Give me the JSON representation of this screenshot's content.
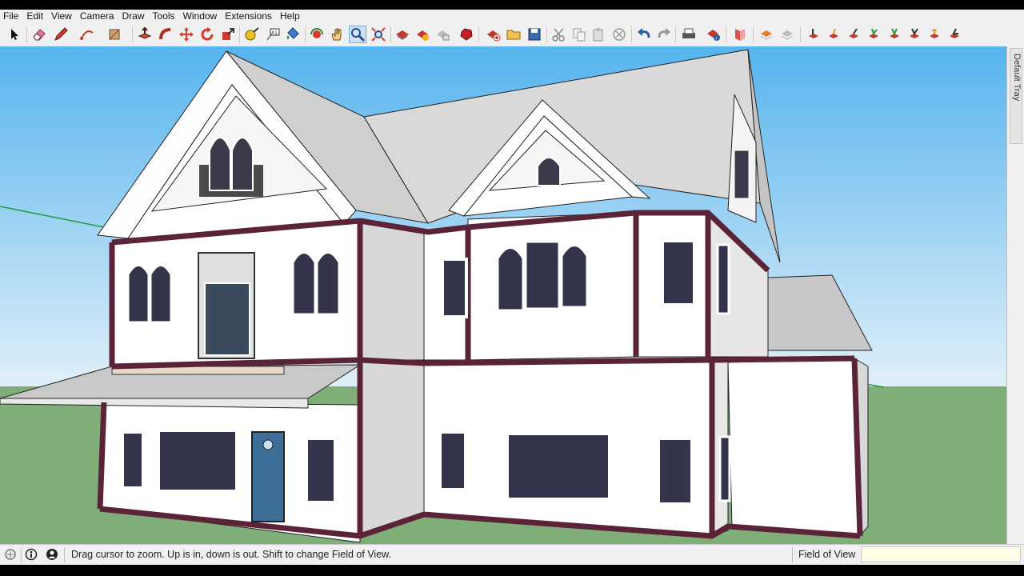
{
  "menu": [
    "File",
    "Edit",
    "View",
    "Camera",
    "Draw",
    "Tools",
    "Window",
    "Extensions",
    "Help"
  ],
  "toolbar": {
    "tools": [
      {
        "name": "select-tool",
        "icon": "arrow-cursor-icon"
      },
      {
        "name": "eraser-tool",
        "icon": "eraser-icon"
      },
      {
        "name": "line-tool",
        "icon": "pencil-icon"
      },
      {
        "name": "arc-tool",
        "icon": "arc-icon"
      },
      {
        "name": "shape-tool",
        "icon": "rectangle-icon"
      },
      {
        "name": "push-pull-tool",
        "icon": "push-pull-icon"
      },
      {
        "name": "follow-me-tool",
        "icon": "follow-me-icon"
      },
      {
        "name": "move-tool",
        "icon": "move-icon"
      },
      {
        "name": "rotate-tool",
        "icon": "rotate-icon"
      },
      {
        "name": "scale-tool",
        "icon": "scale-icon"
      },
      {
        "name": "tape-measure-tool",
        "icon": "tape-measure-icon"
      },
      {
        "name": "text-tool",
        "icon": "text-icon"
      },
      {
        "name": "paint-bucket-tool",
        "icon": "paint-bucket-icon"
      },
      {
        "name": "orbit-tool",
        "icon": "orbit-icon"
      },
      {
        "name": "pan-tool",
        "icon": "hand-icon"
      },
      {
        "name": "zoom-tool",
        "icon": "magnifier-icon"
      },
      {
        "name": "zoom-extents-tool",
        "icon": "zoom-extents-icon"
      },
      {
        "name": "3d-warehouse-button",
        "icon": "warehouse-icon"
      },
      {
        "name": "share-component-button",
        "icon": "component-share-icon"
      },
      {
        "name": "share-model-button",
        "icon": "model-share-icon"
      },
      {
        "name": "extension-warehouse-button",
        "icon": "ruby-icon"
      },
      {
        "name": "new-file-button",
        "icon": "new-file-icon"
      },
      {
        "name": "open-file-button",
        "icon": "folder-icon"
      },
      {
        "name": "save-file-button",
        "icon": "floppy-icon"
      },
      {
        "name": "cut-button",
        "icon": "scissors-icon"
      },
      {
        "name": "copy-button",
        "icon": "copy-icon"
      },
      {
        "name": "paste-button",
        "icon": "paste-icon"
      },
      {
        "name": "delete-button",
        "icon": "delete-icon"
      },
      {
        "name": "undo-button",
        "icon": "undo-icon"
      },
      {
        "name": "redo-button",
        "icon": "redo-icon"
      },
      {
        "name": "print-button",
        "icon": "printer-icon"
      },
      {
        "name": "model-info-button",
        "icon": "model-info-icon"
      },
      {
        "name": "section-plane-button",
        "icon": "section-icon"
      },
      {
        "name": "layer-1-button",
        "icon": "layer-icon"
      },
      {
        "name": "layer-2-button",
        "icon": "layer-icon"
      },
      {
        "name": "ext-1",
        "icon": "ext-icon"
      },
      {
        "name": "ext-2",
        "icon": "ext-icon"
      },
      {
        "name": "ext-3",
        "icon": "ext-icon"
      },
      {
        "name": "ext-4",
        "icon": "ext-icon"
      },
      {
        "name": "ext-5",
        "icon": "ext-icon"
      },
      {
        "name": "ext-6",
        "icon": "ext-icon"
      },
      {
        "name": "ext-7",
        "icon": "ext-icon"
      },
      {
        "name": "ext-8",
        "icon": "ext-icon"
      }
    ],
    "active_tool": "zoom-tool"
  },
  "tray": {
    "label": "Default Tray"
  },
  "status": {
    "message": "Drag cursor to zoom.  Up is in, down is out. Shift to change Field of View.",
    "vcb_label": "Field of View",
    "vcb_value": ""
  },
  "colors": {
    "sky_top": "#5cb8f0",
    "sky_bottom": "#dfeef8",
    "ground": "#7fae78",
    "wall": "#ffffff",
    "wall_side": "#d6d6d6",
    "roof": "#d9d9d9",
    "trim": "#5b2337",
    "door": "#3e6f98"
  }
}
